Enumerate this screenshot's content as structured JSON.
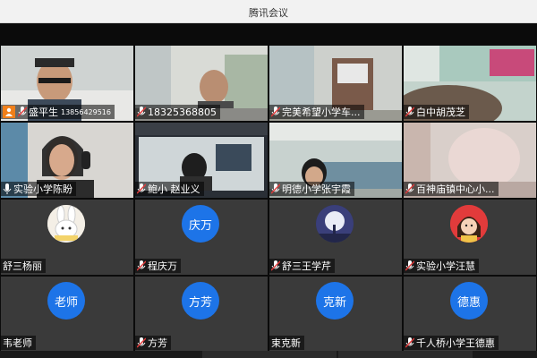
{
  "window": {
    "title": "腾讯会议"
  },
  "participants": [
    {
      "name": "盛平生",
      "extra": "13856429516",
      "type": "video",
      "host": true
    },
    {
      "name": "18325368805",
      "type": "video"
    },
    {
      "name": "完美希望小学车...",
      "type": "video"
    },
    {
      "name": "白中胡茂芝",
      "type": "video"
    },
    {
      "name": "实验小学陈盼",
      "type": "video"
    },
    {
      "name": "鲍小 赵业义",
      "type": "video"
    },
    {
      "name": "明德小学张宇霞",
      "type": "video"
    },
    {
      "name": "百神庙镇中心小...",
      "type": "video"
    },
    {
      "name": "舒三杨丽",
      "type": "avatar-image",
      "icon": "rabbit-icon"
    },
    {
      "name": "程庆万",
      "type": "avatar-text",
      "avatar": "庆万"
    },
    {
      "name": "舒三王学芹",
      "type": "avatar-image",
      "icon": "moon-night-icon"
    },
    {
      "name": "实验小学汪慧",
      "type": "avatar-image",
      "icon": "cartoon-girl-icon"
    },
    {
      "name": "韦老师",
      "type": "avatar-text",
      "avatar": "老师"
    },
    {
      "name": "方芳",
      "type": "avatar-text",
      "avatar": "方芳"
    },
    {
      "name": "束克新",
      "type": "avatar-text",
      "avatar": "克新"
    },
    {
      "name": "千人桥小学王德惠",
      "type": "avatar-text",
      "avatar": "德惠"
    }
  ],
  "colors": {
    "avatar_blue": "#1d74e8",
    "host_badge": "#f07f1a",
    "mic_red": "#e03a3a"
  }
}
